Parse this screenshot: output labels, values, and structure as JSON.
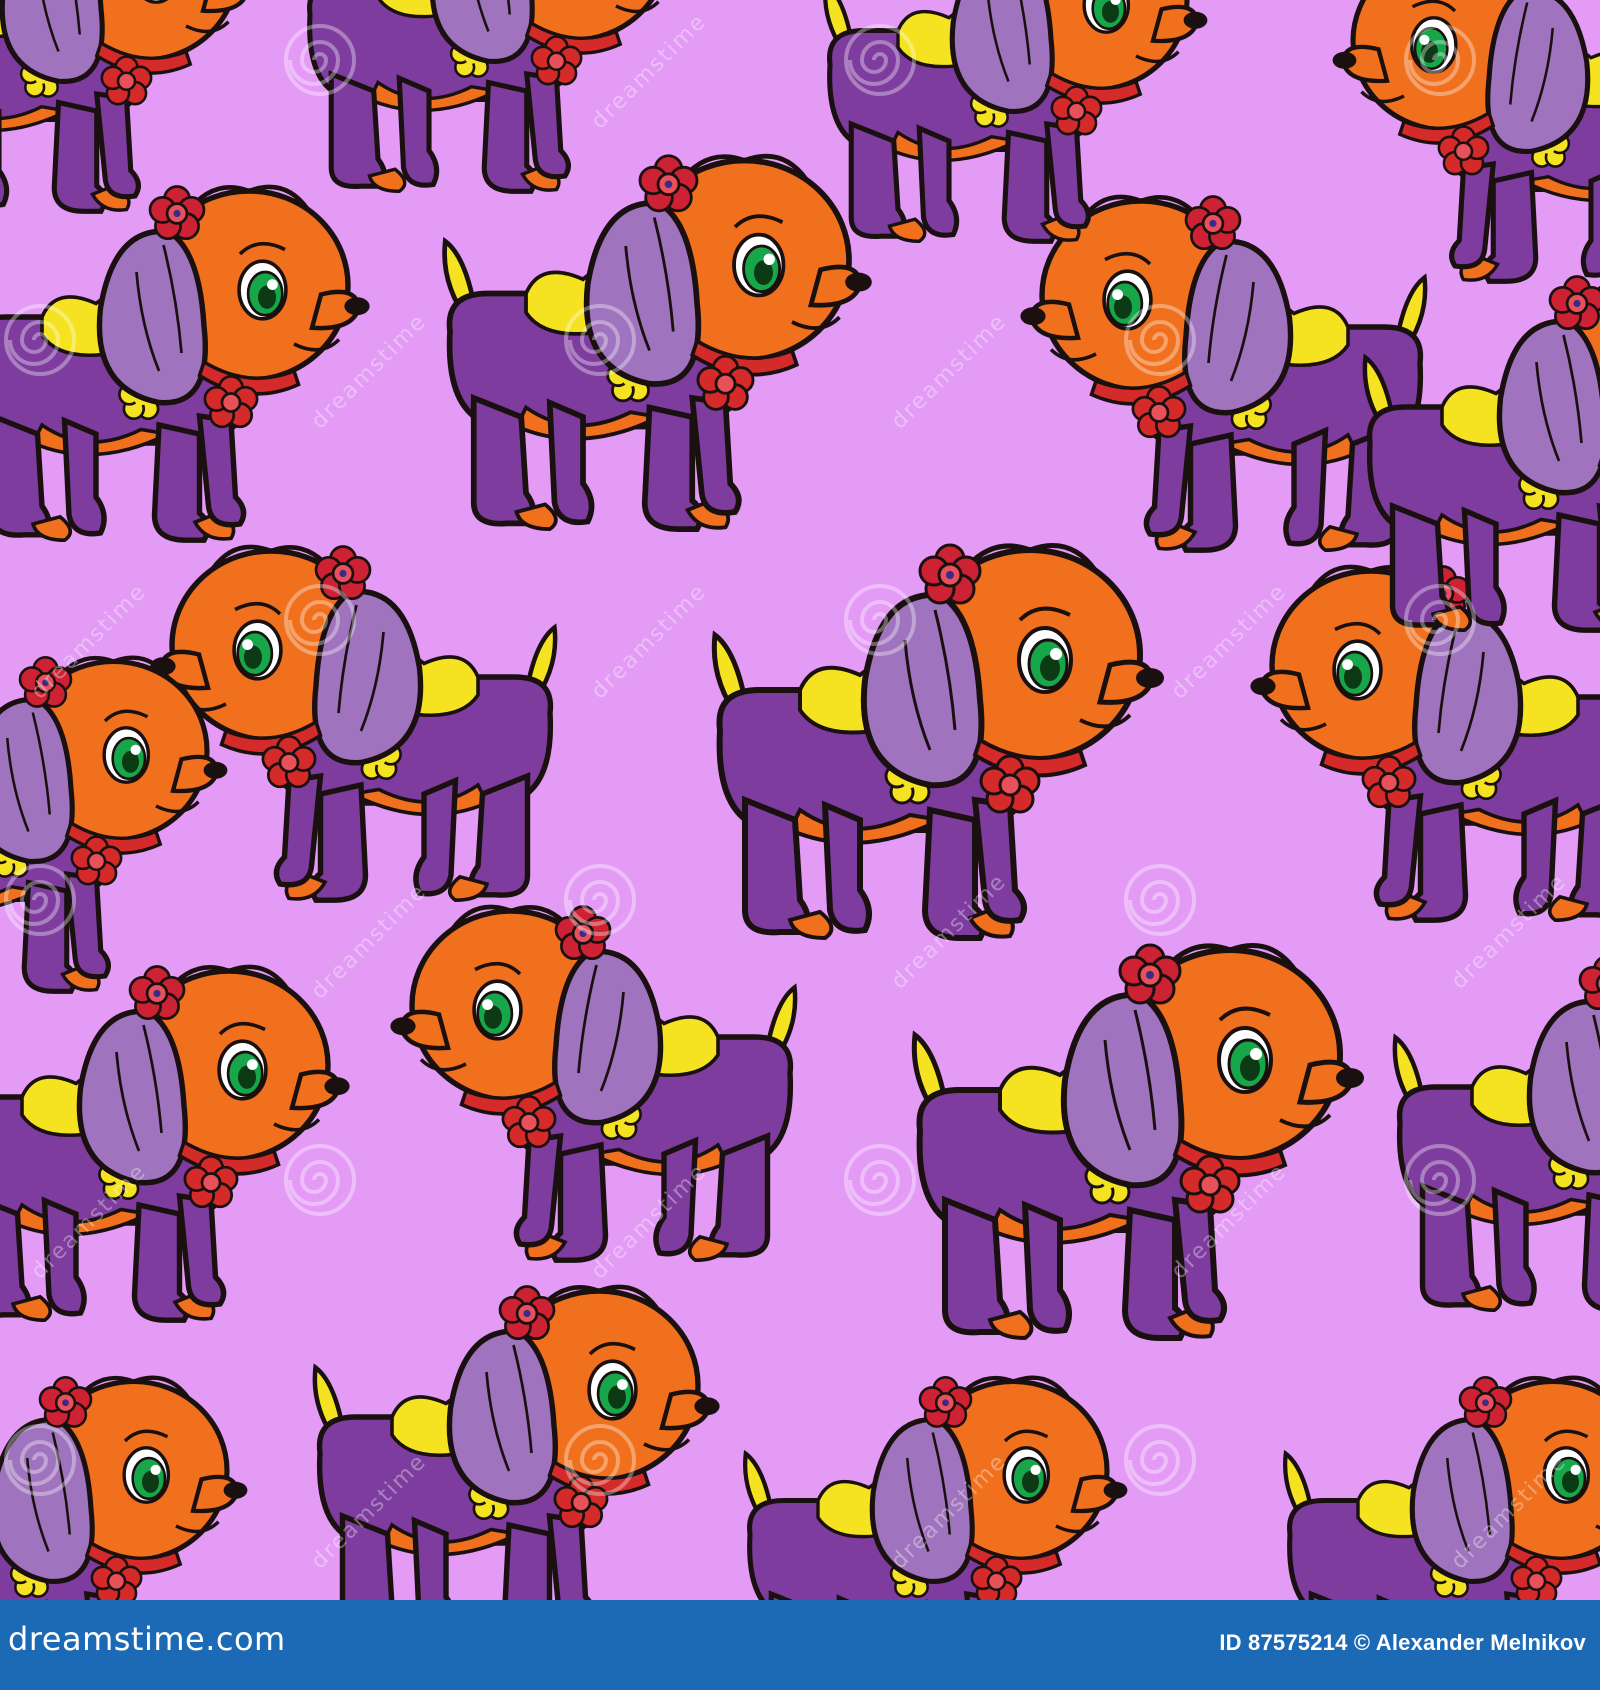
{
  "image": {
    "subject": "Seamless pattern of cartoon puppies",
    "background_color": "#e39bf6",
    "puppy_colors": {
      "head": "#f0701e",
      "body": "#7d3c9e",
      "ears": "#9f73bd",
      "spots_and_tail": "#f5e322",
      "collar": "#d42a2a",
      "flower": "#cc2233",
      "eye": "#18a64a",
      "outline": "#1a1010"
    }
  },
  "watermark": {
    "text": "dreamstime",
    "swirl_icon": "spiral-watermark-icon"
  },
  "footer": {
    "site_url": "dreamstime.com",
    "image_id": "ID 87575214",
    "copyright": "© Alexander Melnikov",
    "background_color": "#1c6ab5"
  }
}
